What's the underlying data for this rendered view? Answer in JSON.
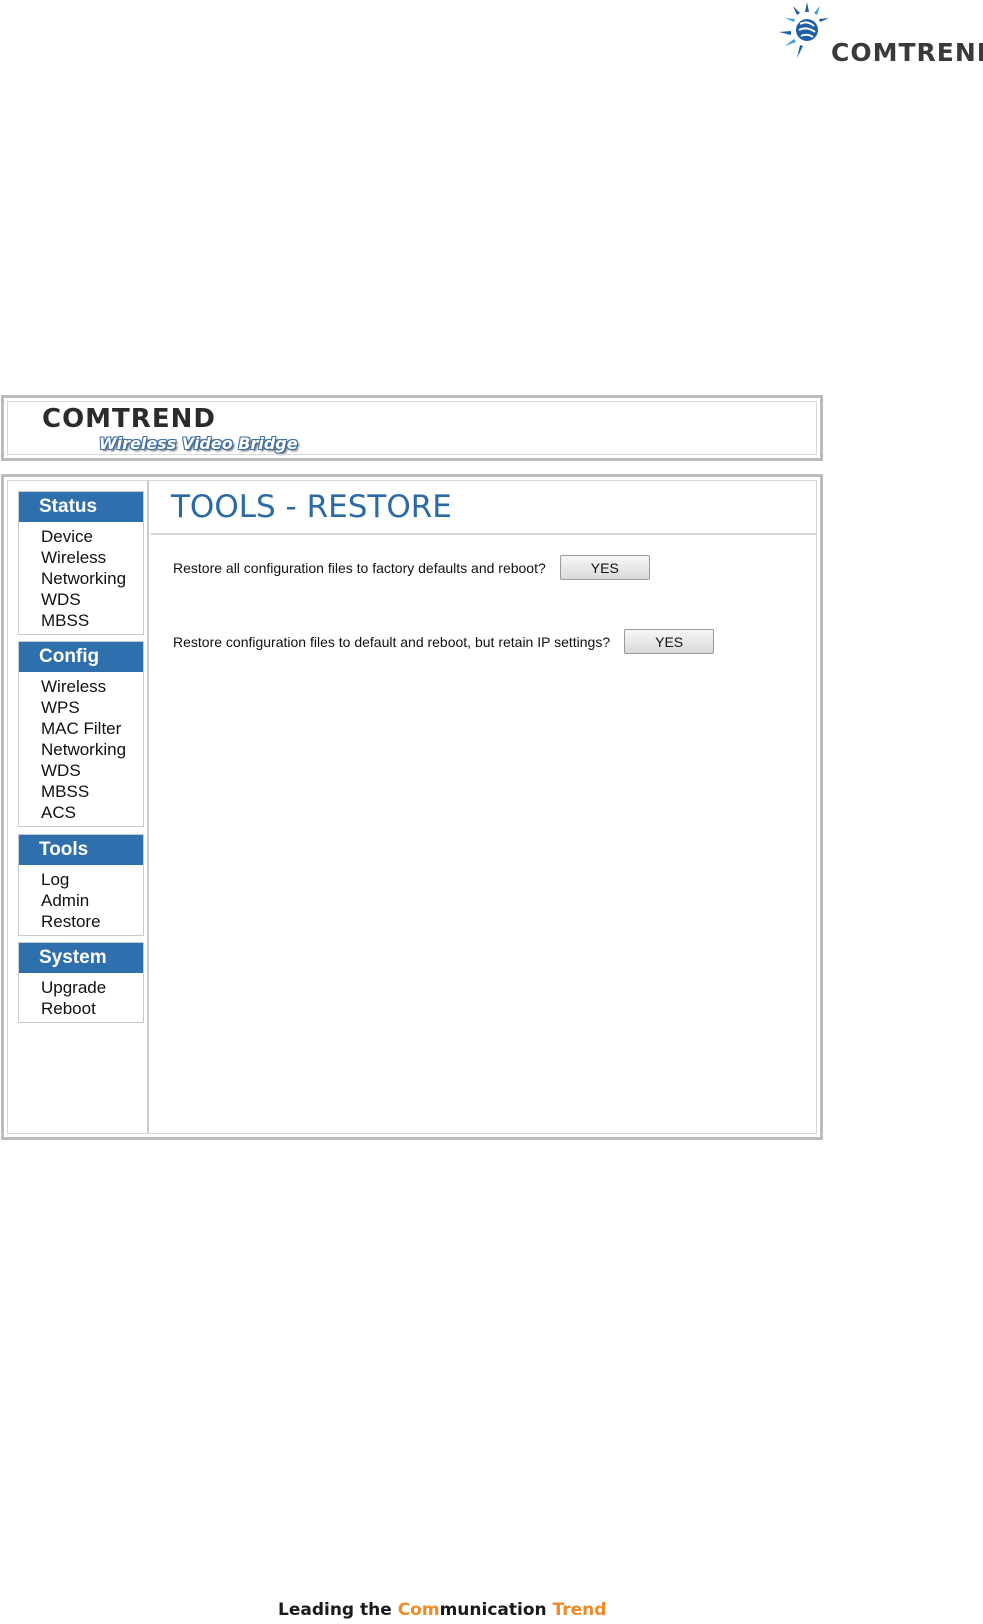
{
  "corp_logo": {
    "text": "COMTREND"
  },
  "header": {
    "brand": "COMTREND",
    "subtitle": "Wireless Video Bridge"
  },
  "sidebar": {
    "groups": [
      {
        "title": "Status",
        "items": [
          "Device",
          "Wireless",
          "Networking",
          "WDS",
          "MBSS"
        ]
      },
      {
        "title": "Config",
        "items": [
          "Wireless",
          "WPS",
          "MAC Filter",
          "Networking",
          "WDS",
          "MBSS",
          "ACS"
        ]
      },
      {
        "title": "Tools",
        "items": [
          "Log",
          "Admin",
          "Restore"
        ]
      },
      {
        "title": "System",
        "items": [
          "Upgrade",
          "Reboot"
        ]
      }
    ]
  },
  "main": {
    "title": "TOOLS - RESTORE",
    "rows": [
      {
        "question": "Restore all configuration files to factory defaults and reboot?",
        "button": "YES"
      },
      {
        "question": "Restore configuration files to default and reboot, but retain IP settings?",
        "button": "YES"
      }
    ]
  },
  "footer": {
    "part1": "Leading the ",
    "part2": "Com",
    "part3": "munication ",
    "part4": "Trend"
  },
  "colors": {
    "nav_header": "#2f6fae",
    "title": "#2b6aa6",
    "accent_orange": "#f08a24"
  }
}
